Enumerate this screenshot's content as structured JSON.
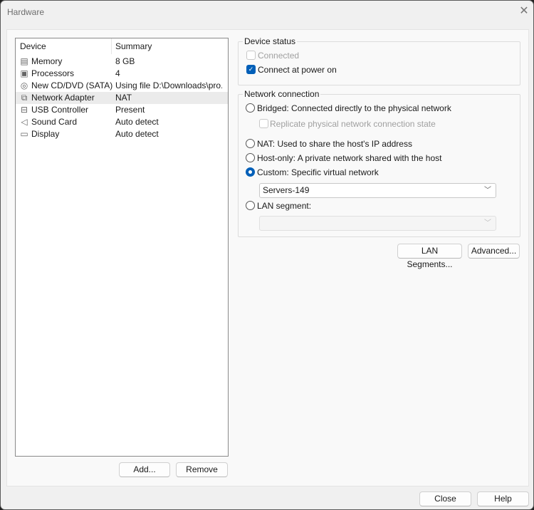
{
  "window": {
    "title": "Hardware",
    "close_icon": "close-icon"
  },
  "device_list": {
    "headers": {
      "device": "Device",
      "summary": "Summary"
    },
    "rows": [
      {
        "device": "Memory",
        "summary": "8 GB",
        "icon": "memory-icon"
      },
      {
        "device": "Processors",
        "summary": "4",
        "icon": "processor-icon"
      },
      {
        "device": "New CD/DVD (SATA)",
        "summary": "Using file D:\\Downloads\\pro...",
        "icon": "cd-dvd-icon"
      },
      {
        "device": "Network Adapter",
        "summary": "NAT",
        "icon": "network-adapter-icon",
        "selected": true
      },
      {
        "device": "USB Controller",
        "summary": "Present",
        "icon": "usb-icon"
      },
      {
        "device": "Sound Card",
        "summary": "Auto detect",
        "icon": "speaker-icon"
      },
      {
        "device": "Display",
        "summary": "Auto detect",
        "icon": "monitor-icon"
      }
    ],
    "add_label": "Add...",
    "remove_label": "Remove"
  },
  "device_status": {
    "title": "Device status",
    "connected": {
      "label": "Connected",
      "checked": false,
      "disabled": true
    },
    "connect_power_on": {
      "label": "Connect at power on",
      "checked": true
    }
  },
  "network_connection": {
    "title": "Network connection",
    "bridged": "Bridged: Connected directly to the physical network",
    "replicate": "Replicate physical network connection state",
    "nat": "NAT: Used to share the host's IP address",
    "hostonly": "Host-only: A private network shared with the host",
    "custom": "Custom: Specific virtual network",
    "custom_value": "Servers-149",
    "lan": "LAN segment:",
    "lan_value": "",
    "selected": "custom"
  },
  "buttons": {
    "lan_segments": "LAN Segments...",
    "advanced": "Advanced...",
    "close": "Close",
    "help": "Help"
  },
  "colors": {
    "accent": "#005fb8"
  }
}
